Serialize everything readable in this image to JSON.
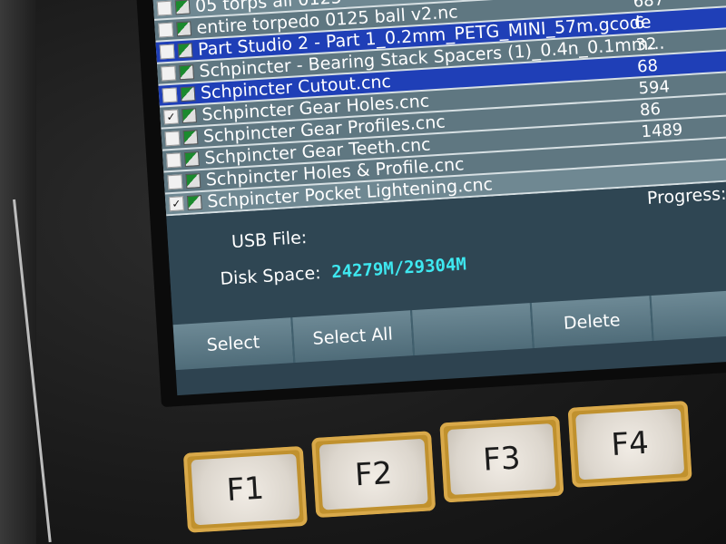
{
  "file_list": {
    "rows": [
      {
        "name": "05 torps all 0125",
        "size": "",
        "checked": false,
        "style": "light"
      },
      {
        "name": "entire torpedo 0125 ball v2.nc",
        "size": "687",
        "checked": false,
        "style": "dim"
      },
      {
        "name": "Part Studio 2 - Part 1_0.2mm_PETG_MINI_57m.gcode",
        "size": "6",
        "checked": false,
        "style": "selected"
      },
      {
        "name": "Schpincter - Bearing Stack Spacers (1)_0.4n_0.1mm...",
        "size": "32",
        "checked": false,
        "style": "dim"
      },
      {
        "name": "Schpincter Cutout.cnc",
        "size": "68",
        "checked": false,
        "style": "selected"
      },
      {
        "name": "Schpincter Gear Holes.cnc",
        "size": "594",
        "checked": true,
        "style": "dim"
      },
      {
        "name": "Schpincter Gear Profiles.cnc",
        "size": "86",
        "checked": false,
        "style": "dim"
      },
      {
        "name": "Schpincter Gear Teeth.cnc",
        "size": "1489",
        "checked": false,
        "style": "dim"
      },
      {
        "name": "Schpincter Holes & Profile.cnc",
        "size": "",
        "checked": false,
        "style": "dim"
      },
      {
        "name": "Schpincter Pocket Lightening.cnc",
        "size": "",
        "checked": true,
        "style": "light"
      }
    ]
  },
  "info": {
    "usb_file_label": "USB File:",
    "usb_file_value": "",
    "disk_space_label": "Disk Space:",
    "disk_space_value": "24279M/29304M",
    "progress_label": "Progress:"
  },
  "softkeys": [
    "Select",
    "Select All",
    "",
    "Delete",
    ""
  ],
  "function_keys": [
    "F1",
    "F2",
    "F3",
    "F4"
  ],
  "colors": {
    "selected_row": "#1f3fb7",
    "disk_value": "#3ee8f0",
    "fkey_border": "#c0912e"
  }
}
